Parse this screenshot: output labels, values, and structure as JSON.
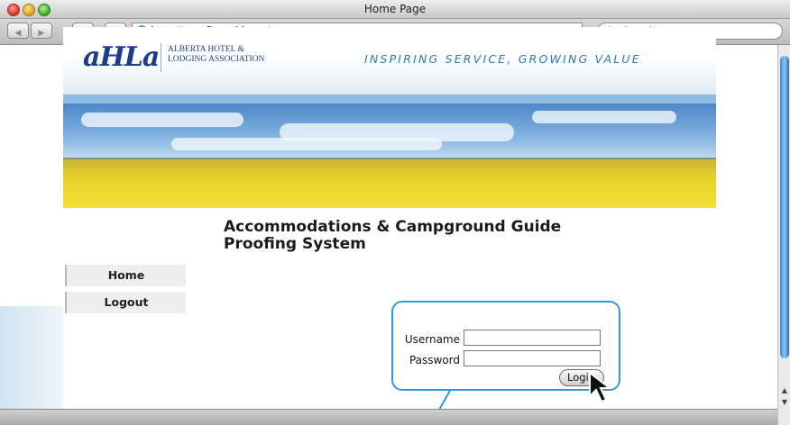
{
  "window": {
    "title": "Home Page"
  },
  "toolbar": {
    "back": "◀",
    "forward": "▶",
    "reload": "c",
    "add": "+",
    "url": "http://proofing.ahla.ca/",
    "search_placeholder": "Q▾ Google"
  },
  "site": {
    "logo_text": "aHLa",
    "org_name": "ALBERTA HOTEL &\nLODGING ASSOCIATION",
    "tagline": "INSPIRING SERVICE, GROWING VALUE",
    "menu": [
      {
        "label": "Home"
      },
      {
        "label": "Logout"
      }
    ],
    "title_line1": "Accommodations & Campground Guide",
    "title_line2": "Proofing System"
  },
  "login": {
    "username_label": "Username",
    "username_value": "",
    "password_label": "Password",
    "password_value": "",
    "button_label": "Login"
  },
  "colors": {
    "brand_blue": "#1c3d8e",
    "tagline_blue": "#2a78b8",
    "callout_blue": "#2e9bd8"
  }
}
